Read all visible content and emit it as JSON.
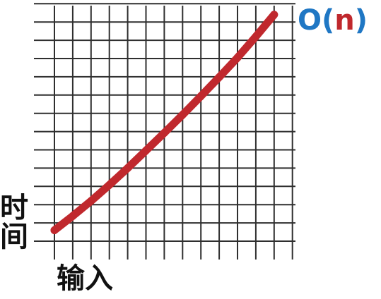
{
  "chart_data": {
    "type": "line",
    "title": {
      "parts": [
        "O(",
        "n",
        ")"
      ],
      "colors": [
        "#1f77c4",
        "#c0282d",
        "#1f77c4"
      ]
    },
    "xlabel": "输入",
    "ylabel_lines": [
      "时",
      "间"
    ],
    "xlim": [
      0,
      13
    ],
    "ylim": [
      0,
      13
    ],
    "grid": true,
    "line_color": "#c0282d",
    "series": [
      {
        "x": [
          0,
          1,
          2,
          3,
          4,
          5,
          6,
          7,
          8,
          9,
          10,
          11,
          12
        ],
        "y": [
          0.6,
          1.38,
          2.2,
          3.08,
          4.0,
          4.96,
          5.93,
          6.92,
          7.94,
          8.98,
          10.05,
          11.2,
          12.4
        ]
      }
    ]
  }
}
